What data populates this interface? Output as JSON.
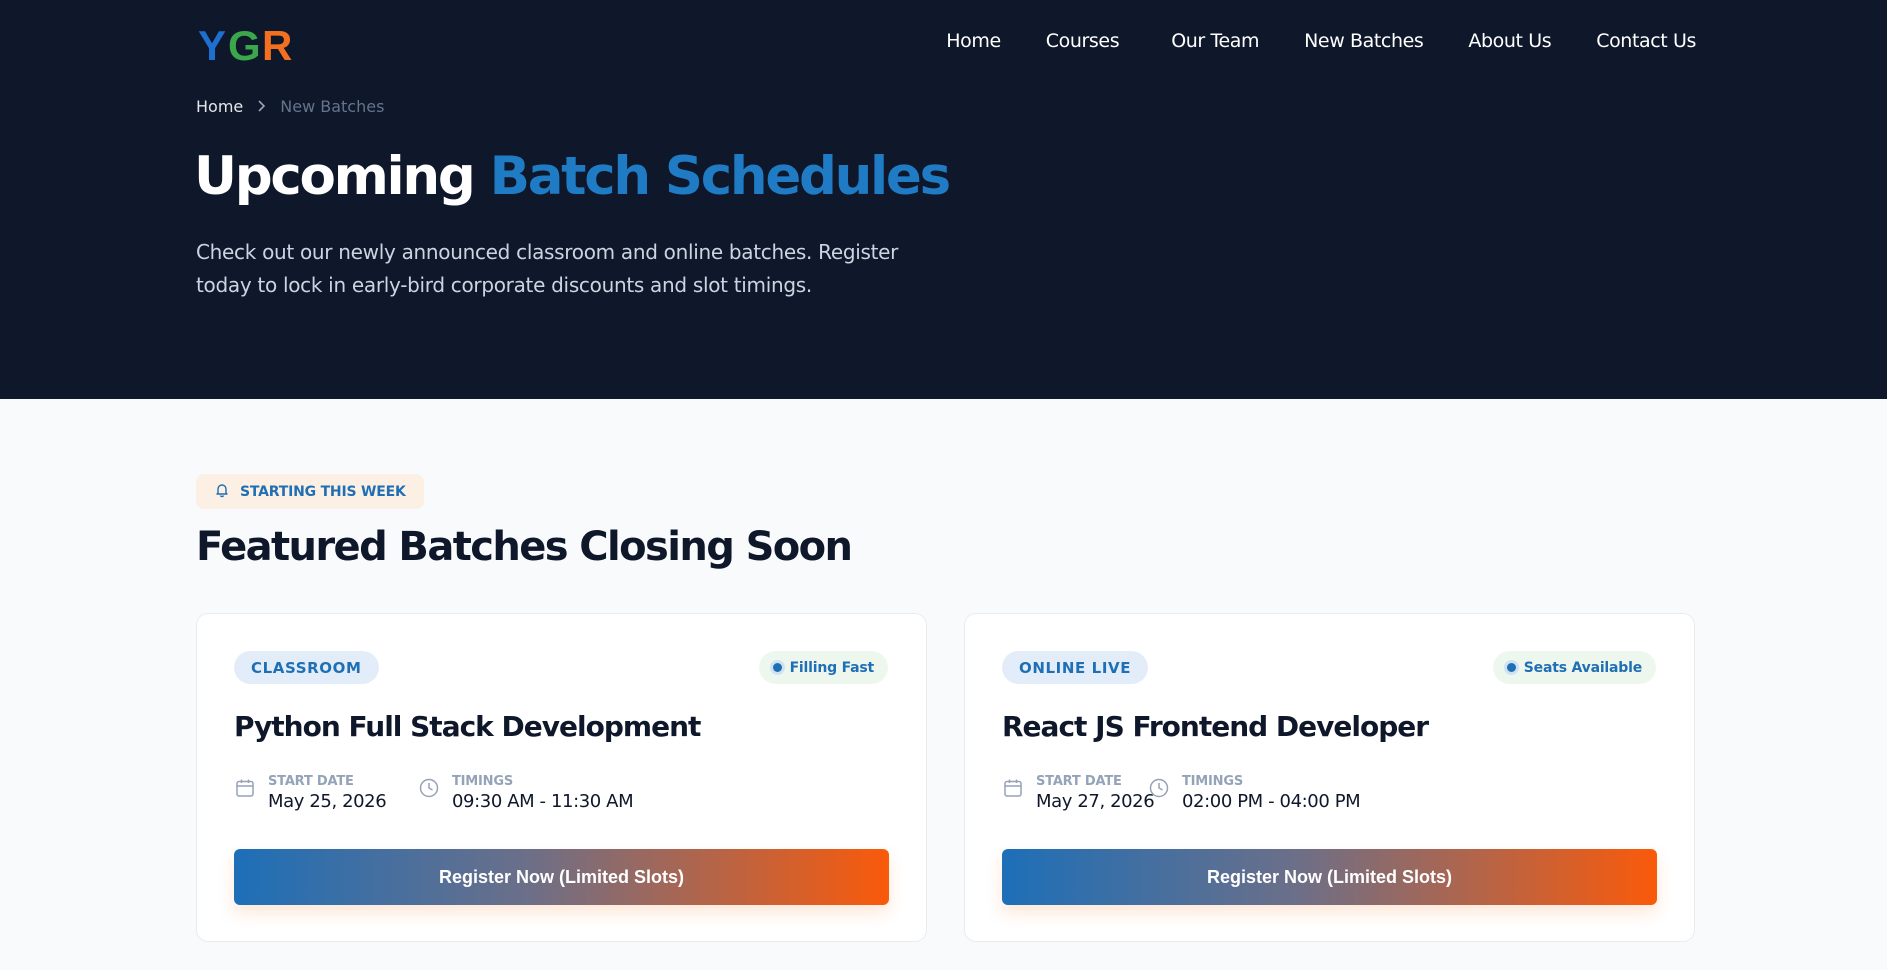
{
  "brand": {
    "logo_text": "YGR",
    "colors": {
      "y": "#1f6fd0",
      "g": "#3aa84a",
      "r": "#f2701f"
    }
  },
  "nav": {
    "items": [
      {
        "label": "Home"
      },
      {
        "label": "Courses"
      },
      {
        "label": "Our Team"
      },
      {
        "label": "New Batches"
      },
      {
        "label": "About Us"
      },
      {
        "label": "Contact Us"
      }
    ]
  },
  "breadcrumb": {
    "home": "Home",
    "current": "New Batches"
  },
  "hero": {
    "title_plain": "Upcoming",
    "title_accent": "Batch Schedules",
    "description": "Check out our newly announced classroom and online batches. Register today to lock in early-bird corporate discounts and slot timings."
  },
  "section": {
    "badge": "STARTING THIS WEEK",
    "title": "Featured Batches Closing Soon"
  },
  "cards": [
    {
      "mode": "CLASSROOM",
      "status": "Filling Fast",
      "title": "Python Full Stack Development",
      "start_label": "START DATE",
      "start_date": "May 25, 2026",
      "timings_label": "TIMINGS",
      "timings": "09:30 AM - 11:30 AM",
      "cta": "Register Now (Limited Slots)"
    },
    {
      "mode": "ONLINE LIVE",
      "status": "Seats Available",
      "title": "React JS Frontend Developer",
      "start_label": "START DATE",
      "start_date": "May 27, 2026",
      "timings_label": "TIMINGS",
      "timings": "02:00 PM - 04:00 PM",
      "cta": "Register Now (Limited Slots)"
    }
  ],
  "colors": {
    "hero_bg": "#0f172a",
    "accent_blue": "#1f7cc4",
    "cta_start": "#1d6fb8",
    "cta_end": "#fa5a0a"
  },
  "icons": {
    "bell": "bell-icon",
    "calendar": "calendar-icon",
    "clock": "clock-icon",
    "chevron": "chevron-right-icon"
  }
}
